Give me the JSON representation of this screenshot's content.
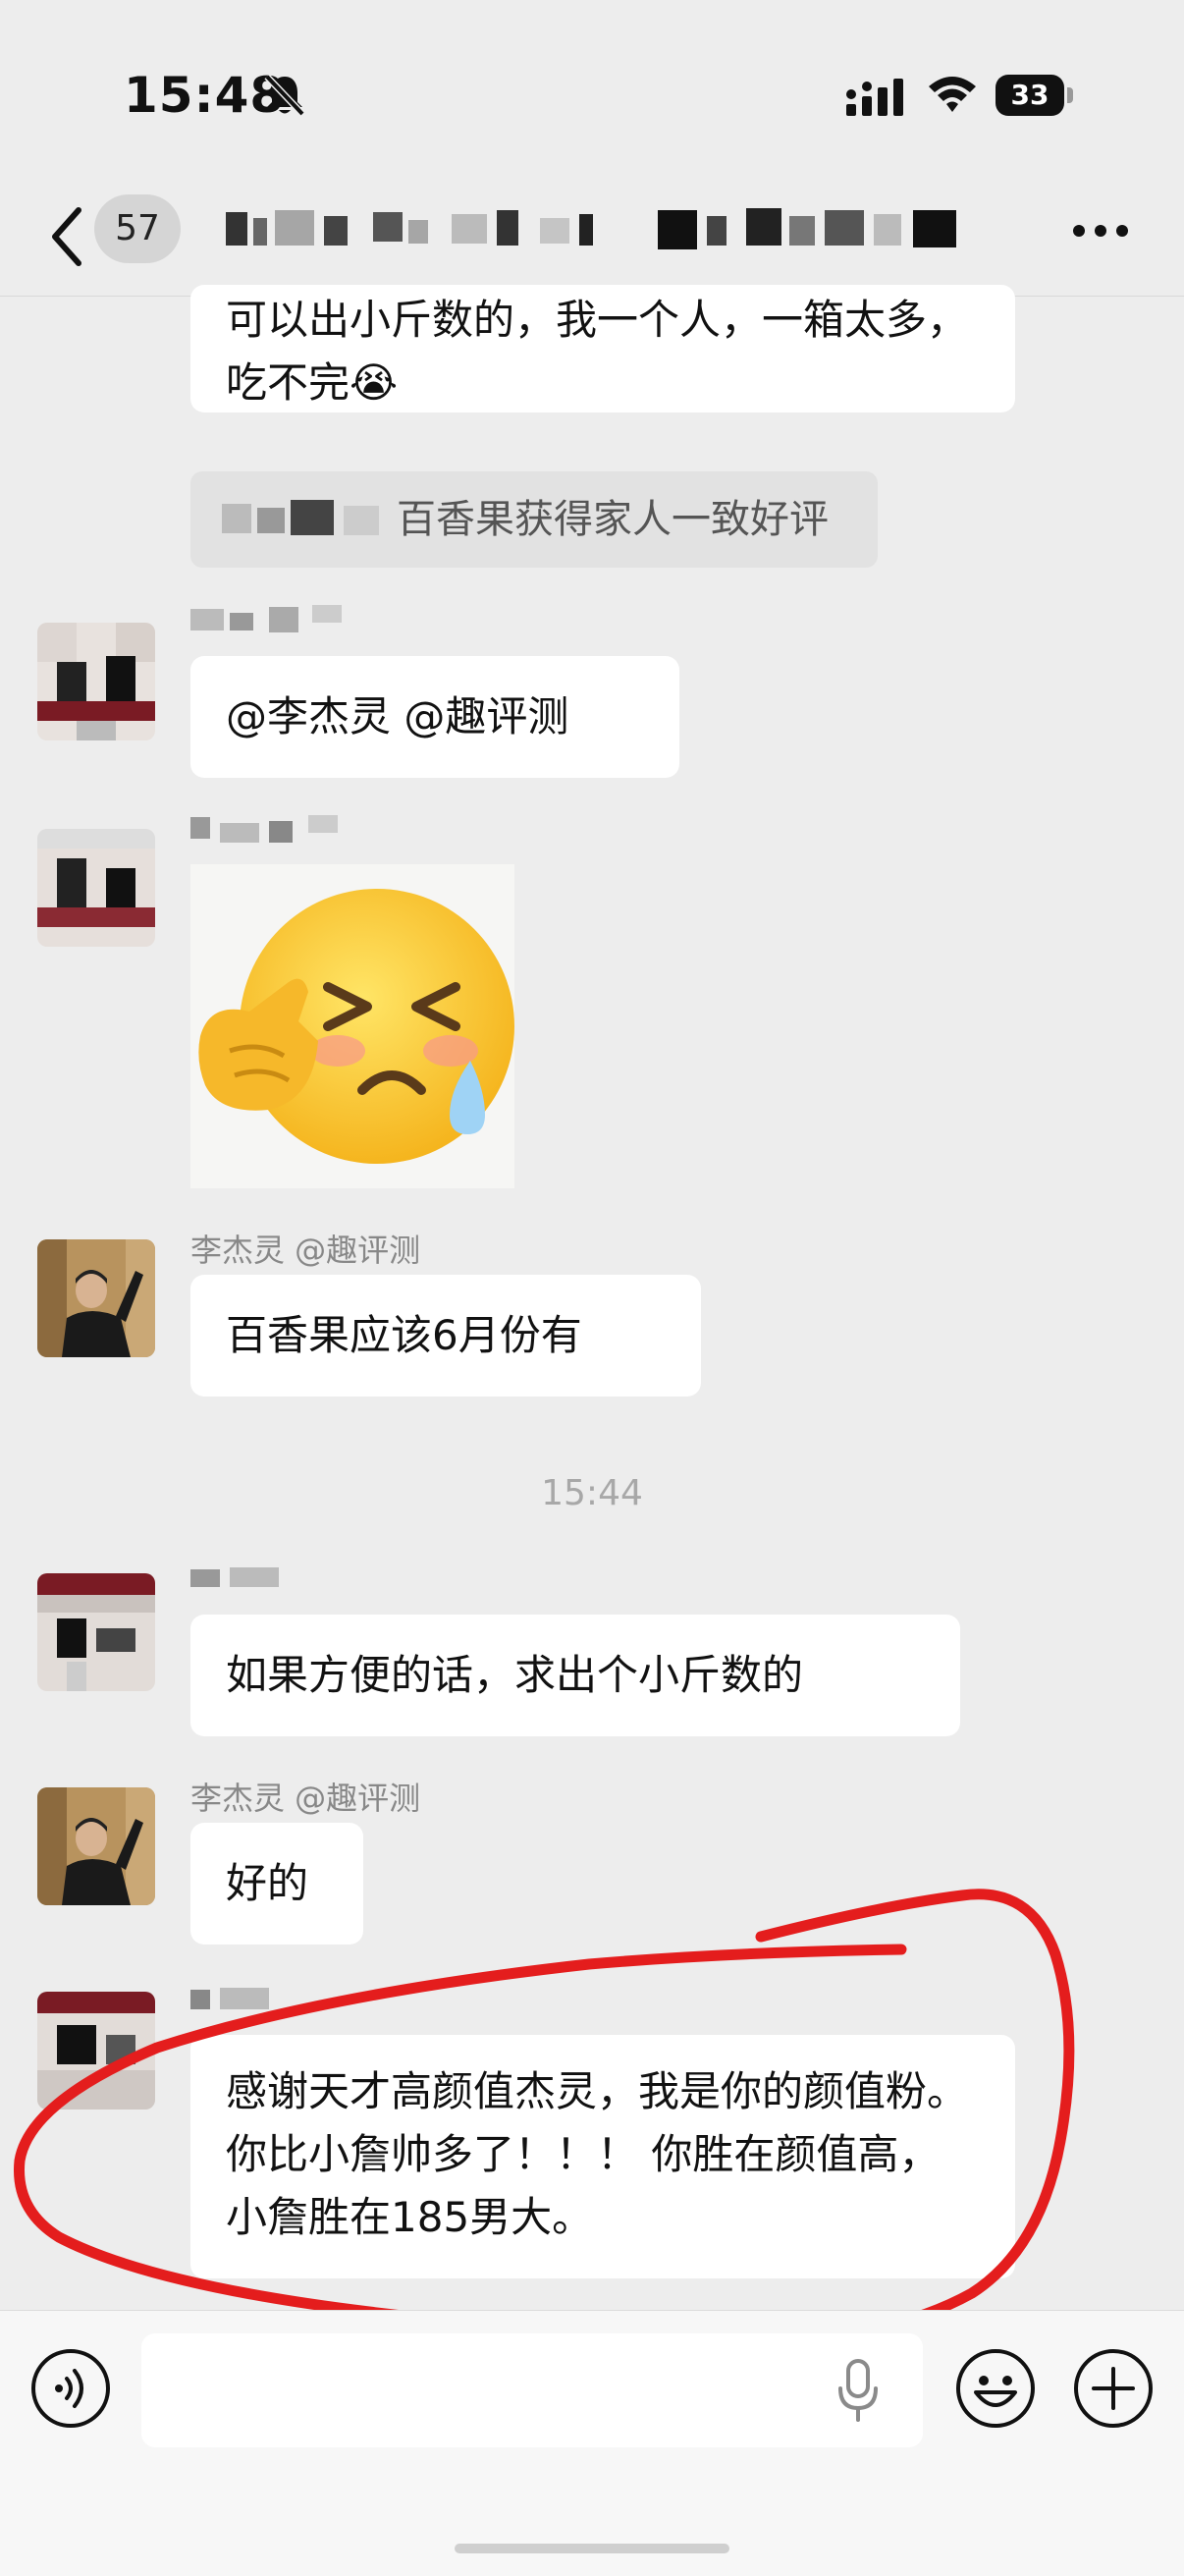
{
  "status_bar": {
    "time": "15:48",
    "battery": "33"
  },
  "nav": {
    "unread_count": "57"
  },
  "messages": {
    "m1_text": "可以出小斤数的，我一个人，一箱太多，吃不完😭",
    "system_tip": "百香果获得家人一致好评",
    "m2_text": "@李杰灵 @趣评测",
    "m4_sender": "李杰灵 @趣评测",
    "m4_text": "百香果应该6月份有",
    "timestamp": "15:44",
    "m5_text": "如果方便的话，求出个小斤数的",
    "m6_sender": "李杰灵 @趣评测",
    "m6_text": "好的",
    "m7_text": "感谢天才高颜值杰灵，我是你的颜值粉。你比小詹帅多了！！！ 你胜在颜值高，小詹胜在185男大。"
  },
  "colors": {
    "background": "#ededed",
    "bubble": "#ffffff",
    "annotation_red": "#e41d1d",
    "sender_gray": "#888888"
  },
  "icons": [
    "silent-bell-icon",
    "signal-icon",
    "wifi-icon",
    "back-chevron-icon",
    "more-dots-icon",
    "voice-input-icon",
    "microphone-icon",
    "emoji-icon",
    "plus-icon"
  ]
}
